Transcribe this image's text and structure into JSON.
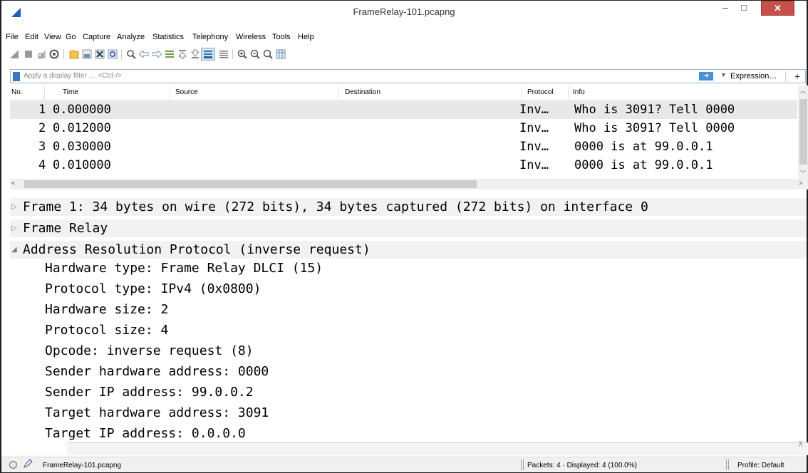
{
  "window": {
    "title": "FrameRelay-101.pcapng",
    "minimize": "–",
    "maximize": "□",
    "close": "✕"
  },
  "menu": [
    "File",
    "Edit",
    "View",
    "Go",
    "Capture",
    "Analyze",
    "Statistics",
    "Telephony",
    "Wireless",
    "Tools",
    "Help"
  ],
  "toolbar_icons": [
    "shark-fin-start-icon",
    "stop-capture-icon",
    "restart-capture-icon",
    "capture-options-icon",
    "open-file-icon",
    "save-file-icon",
    "close-file-icon",
    "reload-file-icon",
    "find-packet-icon",
    "go-back-icon",
    "go-forward-icon",
    "go-to-packet-icon",
    "first-packet-icon",
    "last-packet-icon",
    "autoscroll-icon",
    "colorize-icon",
    "zoom-in-icon",
    "zoom-out-icon",
    "normal-size-icon",
    "resize-columns-icon"
  ],
  "filter": {
    "placeholder": "Apply a display filter … <Ctrl-/>",
    "expression_label": "Expression…",
    "add_label": "+"
  },
  "packet_list": {
    "columns": [
      "No.",
      "Time",
      "Source",
      "Destination",
      "Protocol",
      "Info"
    ],
    "rows": [
      {
        "no": "1",
        "time": "0.000000",
        "source": "",
        "destination": "",
        "protocol": "Inv…",
        "info": "Who is 3091? Tell 0000"
      },
      {
        "no": "2",
        "time": "0.012000",
        "source": "",
        "destination": "",
        "protocol": "Inv…",
        "info": "Who is 3091? Tell 0000"
      },
      {
        "no": "3",
        "time": "0.030000",
        "source": "",
        "destination": "",
        "protocol": "Inv…",
        "info": "0000 is at 99.0.0.1"
      },
      {
        "no": "4",
        "time": "0.010000",
        "source": "",
        "destination": "",
        "protocol": "Inv…",
        "info": "0000 is at 99.0.0.1"
      }
    ]
  },
  "details": {
    "frame": "Frame 1: 34 bytes on wire (272 bits), 34 bytes captured (272 bits) on interface 0",
    "frame_relay": "Frame Relay",
    "arp": "Address Resolution Protocol (inverse request)",
    "arp_fields": [
      "Hardware type: Frame Relay DLCI (15)",
      "Protocol type: IPv4 (0x0800)",
      "Hardware size: 2",
      "Protocol size: 4",
      "Opcode: inverse request (8)",
      "Sender hardware address: 0000",
      "Sender IP address: 99.0.0.2",
      "Target hardware address: 3091",
      "Target IP address: 0.0.0.0"
    ],
    "collapsed_marker": "▷",
    "expanded_marker": "◢"
  },
  "status": {
    "file": "FrameRelay-101.pcapng",
    "packets": "Packets: 4 · Displayed: 4 (100.0%)",
    "profile": "Profile: Default"
  }
}
